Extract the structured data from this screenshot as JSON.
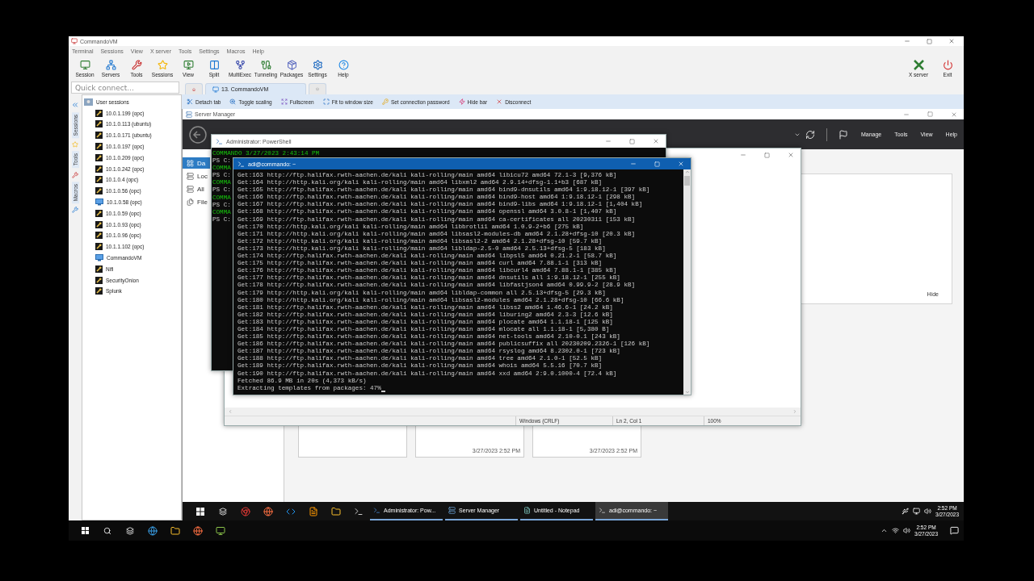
{
  "app": {
    "title": "CommandoVM",
    "menu": [
      "Terminal",
      "Sessions",
      "View",
      "X server",
      "Tools",
      "Settings",
      "Macros",
      "Help"
    ],
    "toolbar": [
      {
        "label": "Session"
      },
      {
        "label": "Servers"
      },
      {
        "label": "Tools"
      },
      {
        "label": "Sessions"
      },
      {
        "label": "View"
      },
      {
        "label": "Split"
      },
      {
        "label": "MultiExec"
      },
      {
        "label": "Tunneling"
      },
      {
        "label": "Packages"
      },
      {
        "label": "Settings"
      },
      {
        "label": "Help"
      }
    ],
    "right_toolbar": [
      {
        "label": "X server"
      },
      {
        "label": "Exit"
      }
    ]
  },
  "quick_connect": {
    "placeholder": "Quick connect..."
  },
  "side_tabs": [
    "Sessions",
    "Tools",
    "Macros"
  ],
  "sessions": {
    "label": "User sessions",
    "children": [
      {
        "label": "10.0.1.199 (opc)",
        "kind": "ssh"
      },
      {
        "label": "10.1.0.113 (ubuntu)",
        "kind": "ssh"
      },
      {
        "label": "10.1.0.171 (ubuntu)",
        "kind": "ssh"
      },
      {
        "label": "10.1.0.197 (opc)",
        "kind": "ssh"
      },
      {
        "label": "10.1.0.209 (opc)",
        "kind": "ssh"
      },
      {
        "label": "10.1.0.242 (opc)",
        "kind": "ssh"
      },
      {
        "label": "10.1.0.4 (opc)",
        "kind": "ssh"
      },
      {
        "label": "10.1.0.56 (opc)",
        "kind": "ssh"
      },
      {
        "label": "10.1.0.58 (opc)",
        "kind": "rdp"
      },
      {
        "label": "10.1.0.59 (opc)",
        "kind": "ssh"
      },
      {
        "label": "10.1.0.93 (opc)",
        "kind": "ssh"
      },
      {
        "label": "10.1.0.96 (opc)",
        "kind": "ssh"
      },
      {
        "label": "10.1.1.102 (opc)",
        "kind": "ssh"
      },
      {
        "label": "CommandoVM",
        "kind": "rdp"
      },
      {
        "label": "Nifi",
        "kind": "ssh"
      },
      {
        "label": "SecurityOnion",
        "kind": "ssh"
      },
      {
        "label": "Splunk",
        "kind": "ssh"
      }
    ]
  },
  "tabs": [
    {
      "label": "13. CommandoVM",
      "selected": true
    }
  ],
  "tab_buttons": [
    "Detach tab",
    "Toggle scaling",
    "Fullscreen",
    "Fit to window size",
    "Set connection password",
    "Hide bar",
    "Disconnect"
  ],
  "server_manager": {
    "title": "Server Manager",
    "menu": [
      "Manage",
      "Tools",
      "View",
      "Help"
    ],
    "nav": [
      {
        "label": "Da",
        "selected": true
      },
      {
        "label": "Loc",
        "selected": false
      },
      {
        "label": "All",
        "selected": false
      },
      {
        "label": "File",
        "selected": false
      }
    ],
    "hide_link": "Hide",
    "cards": [
      {
        "kind": "blank"
      },
      {
        "kind": "dated",
        "time": "3/27/2023 2:52 PM"
      },
      {
        "kind": "dated",
        "time": "3/27/2023 2:52 PM"
      }
    ]
  },
  "notepad": {
    "status": [
      "Windows (CRLF)",
      "Ln 2, Col 1",
      "100%"
    ]
  },
  "powershell": {
    "title": "Administrator: PowerShell",
    "lines": [
      {
        "text": "COMMANDO 3/27/2023 2:43:14 PM",
        "kind": "banner"
      },
      {
        "text": "PS C:",
        "kind": "prompt"
      },
      {
        "text": "COMMA",
        "kind": "banner"
      },
      {
        "text": "PS C:",
        "kind": "prompt"
      },
      {
        "text": "COMMA",
        "kind": "banner"
      },
      {
        "text": "PS C:",
        "kind": "prompt"
      },
      {
        "text": "COMMA",
        "kind": "banner"
      },
      {
        "text": "PS C:",
        "kind": "prompt"
      },
      {
        "text": "COMMA",
        "kind": "banner"
      },
      {
        "text": "PS C:",
        "kind": "prompt"
      }
    ]
  },
  "terminal": {
    "title": "adi@commando: ~",
    "lines": [
      "Get:163 http://ftp.halifax.rwth-aachen.de/kali kali-rolling/main amd64 libicu72 amd64 72.1-3 [9,376 kB]",
      "Get:164 http://http.kali.org/kali kali-rolling/main amd64 libxml2 amd64 2.9.14+dfsg-1.1+b3 [687 kB]",
      "Get:165 http://ftp.halifax.rwth-aachen.de/kali kali-rolling/main amd64 bind9-dnsutils amd64 1:9.18.12-1 [397 kB]",
      "Get:166 http://ftp.halifax.rwth-aachen.de/kali kali-rolling/main amd64 bind9-host amd64 1:9.18.12-1 [298 kB]",
      "Get:167 http://ftp.halifax.rwth-aachen.de/kali kali-rolling/main amd64 bind9-libs amd64 1:9.18.12-1 [1,404 kB]",
      "Get:168 http://ftp.halifax.rwth-aachen.de/kali kali-rolling/main amd64 openssl amd64 3.0.8-1 [1,407 kB]",
      "Get:169 http://ftp.halifax.rwth-aachen.de/kali kali-rolling/main amd64 ca-certificates all 20230311 [153 kB]",
      "Get:170 http://http.kali.org/kali kali-rolling/main amd64 libbrotli1 amd64 1.0.9-2+b6 [275 kB]",
      "Get:171 http://http.kali.org/kali kali-rolling/main amd64 libsasl2-modules-db amd64 2.1.28+dfsg-10 [20.3 kB]",
      "Get:172 http://http.kali.org/kali kali-rolling/main amd64 libsasl2-2 amd64 2.1.28+dfsg-10 [59.7 kB]",
      "Get:173 http://http.kali.org/kali kali-rolling/main amd64 libldap-2.5-0 amd64 2.5.13+dfsg-5 [183 kB]",
      "Get:174 http://ftp.halifax.rwth-aachen.de/kali kali-rolling/main amd64 libpsl5 amd64 0.21.2-1 [58.7 kB]",
      "Get:175 http://ftp.halifax.rwth-aachen.de/kali kali-rolling/main amd64 curl amd64 7.88.1-1 [313 kB]",
      "Get:176 http://ftp.halifax.rwth-aachen.de/kali kali-rolling/main amd64 libcurl4 amd64 7.88.1-1 [385 kB]",
      "Get:177 http://ftp.halifax.rwth-aachen.de/kali kali-rolling/main amd64 dnsutils all 1:9.18.12-1 [255 kB]",
      "Get:178 http://ftp.halifax.rwth-aachen.de/kali kali-rolling/main amd64 libfastjson4 amd64 0.99.9-2 [28.9 kB]",
      "Get:179 http://http.kali.org/kali kali-rolling/main amd64 libldap-common all 2.5.13+dfsg-5 [29.3 kB]",
      "Get:180 http://http.kali.org/kali kali-rolling/main amd64 libsasl2-modules amd64 2.1.28+dfsg-10 [66.6 kB]",
      "Get:181 http://ftp.halifax.rwth-aachen.de/kali kali-rolling/main amd64 libss2 amd64 1.46.6-1 [24.2 kB]",
      "Get:182 http://ftp.halifax.rwth-aachen.de/kali kali-rolling/main amd64 liburing2 amd64 2.3-3 [12.6 kB]",
      "Get:183 http://ftp.halifax.rwth-aachen.de/kali kali-rolling/main amd64 plocate amd64 1.1.18-1 [125 kB]",
      "Get:184 http://ftp.halifax.rwth-aachen.de/kali kali-rolling/main amd64 mlocate all 1.1.18-1 [5,380 B]",
      "Get:185 http://ftp.halifax.rwth-aachen.de/kali kali-rolling/main amd64 net-tools amd64 2.10-0.1 [243 kB]",
      "Get:186 http://ftp.halifax.rwth-aachen.de/kali kali-rolling/main amd64 publicsuffix all 20230209.2326-1 [126 kB]",
      "Get:187 http://ftp.halifax.rwth-aachen.de/kali kali-rolling/main amd64 rsyslog amd64 8.2302.0-1 [723 kB]",
      "Get:188 http://ftp.halifax.rwth-aachen.de/kali kali-rolling/main amd64 tree amd64 2.1.0-1 [52.5 kB]",
      "Get:189 http://ftp.halifax.rwth-aachen.de/kali kali-rolling/main amd64 whois amd64 5.5.16 [70.7 kB]",
      "Get:190 http://ftp.halifax.rwth-aachen.de/kali kali-rolling/main amd64 xxd amd64 2:9.0.1000-4 [72.4 kB]",
      "Fetched 86.9 MB in 20s (4,373 kB/s)",
      "Extracting templates from packages: 47%"
    ]
  },
  "remote_taskbar": {
    "windows": [
      {
        "label": "Administrator: Pow...",
        "selected": false
      },
      {
        "label": "Server Manager",
        "selected": false
      },
      {
        "label": "Untitled - Notepad",
        "selected": false
      },
      {
        "label": "adi@commando: ~",
        "selected": true
      }
    ],
    "time": "2:52 PM",
    "date": "3/27/2023"
  },
  "host_taskbar": {
    "time": "2:52 PM",
    "date": "3/27/2023"
  }
}
